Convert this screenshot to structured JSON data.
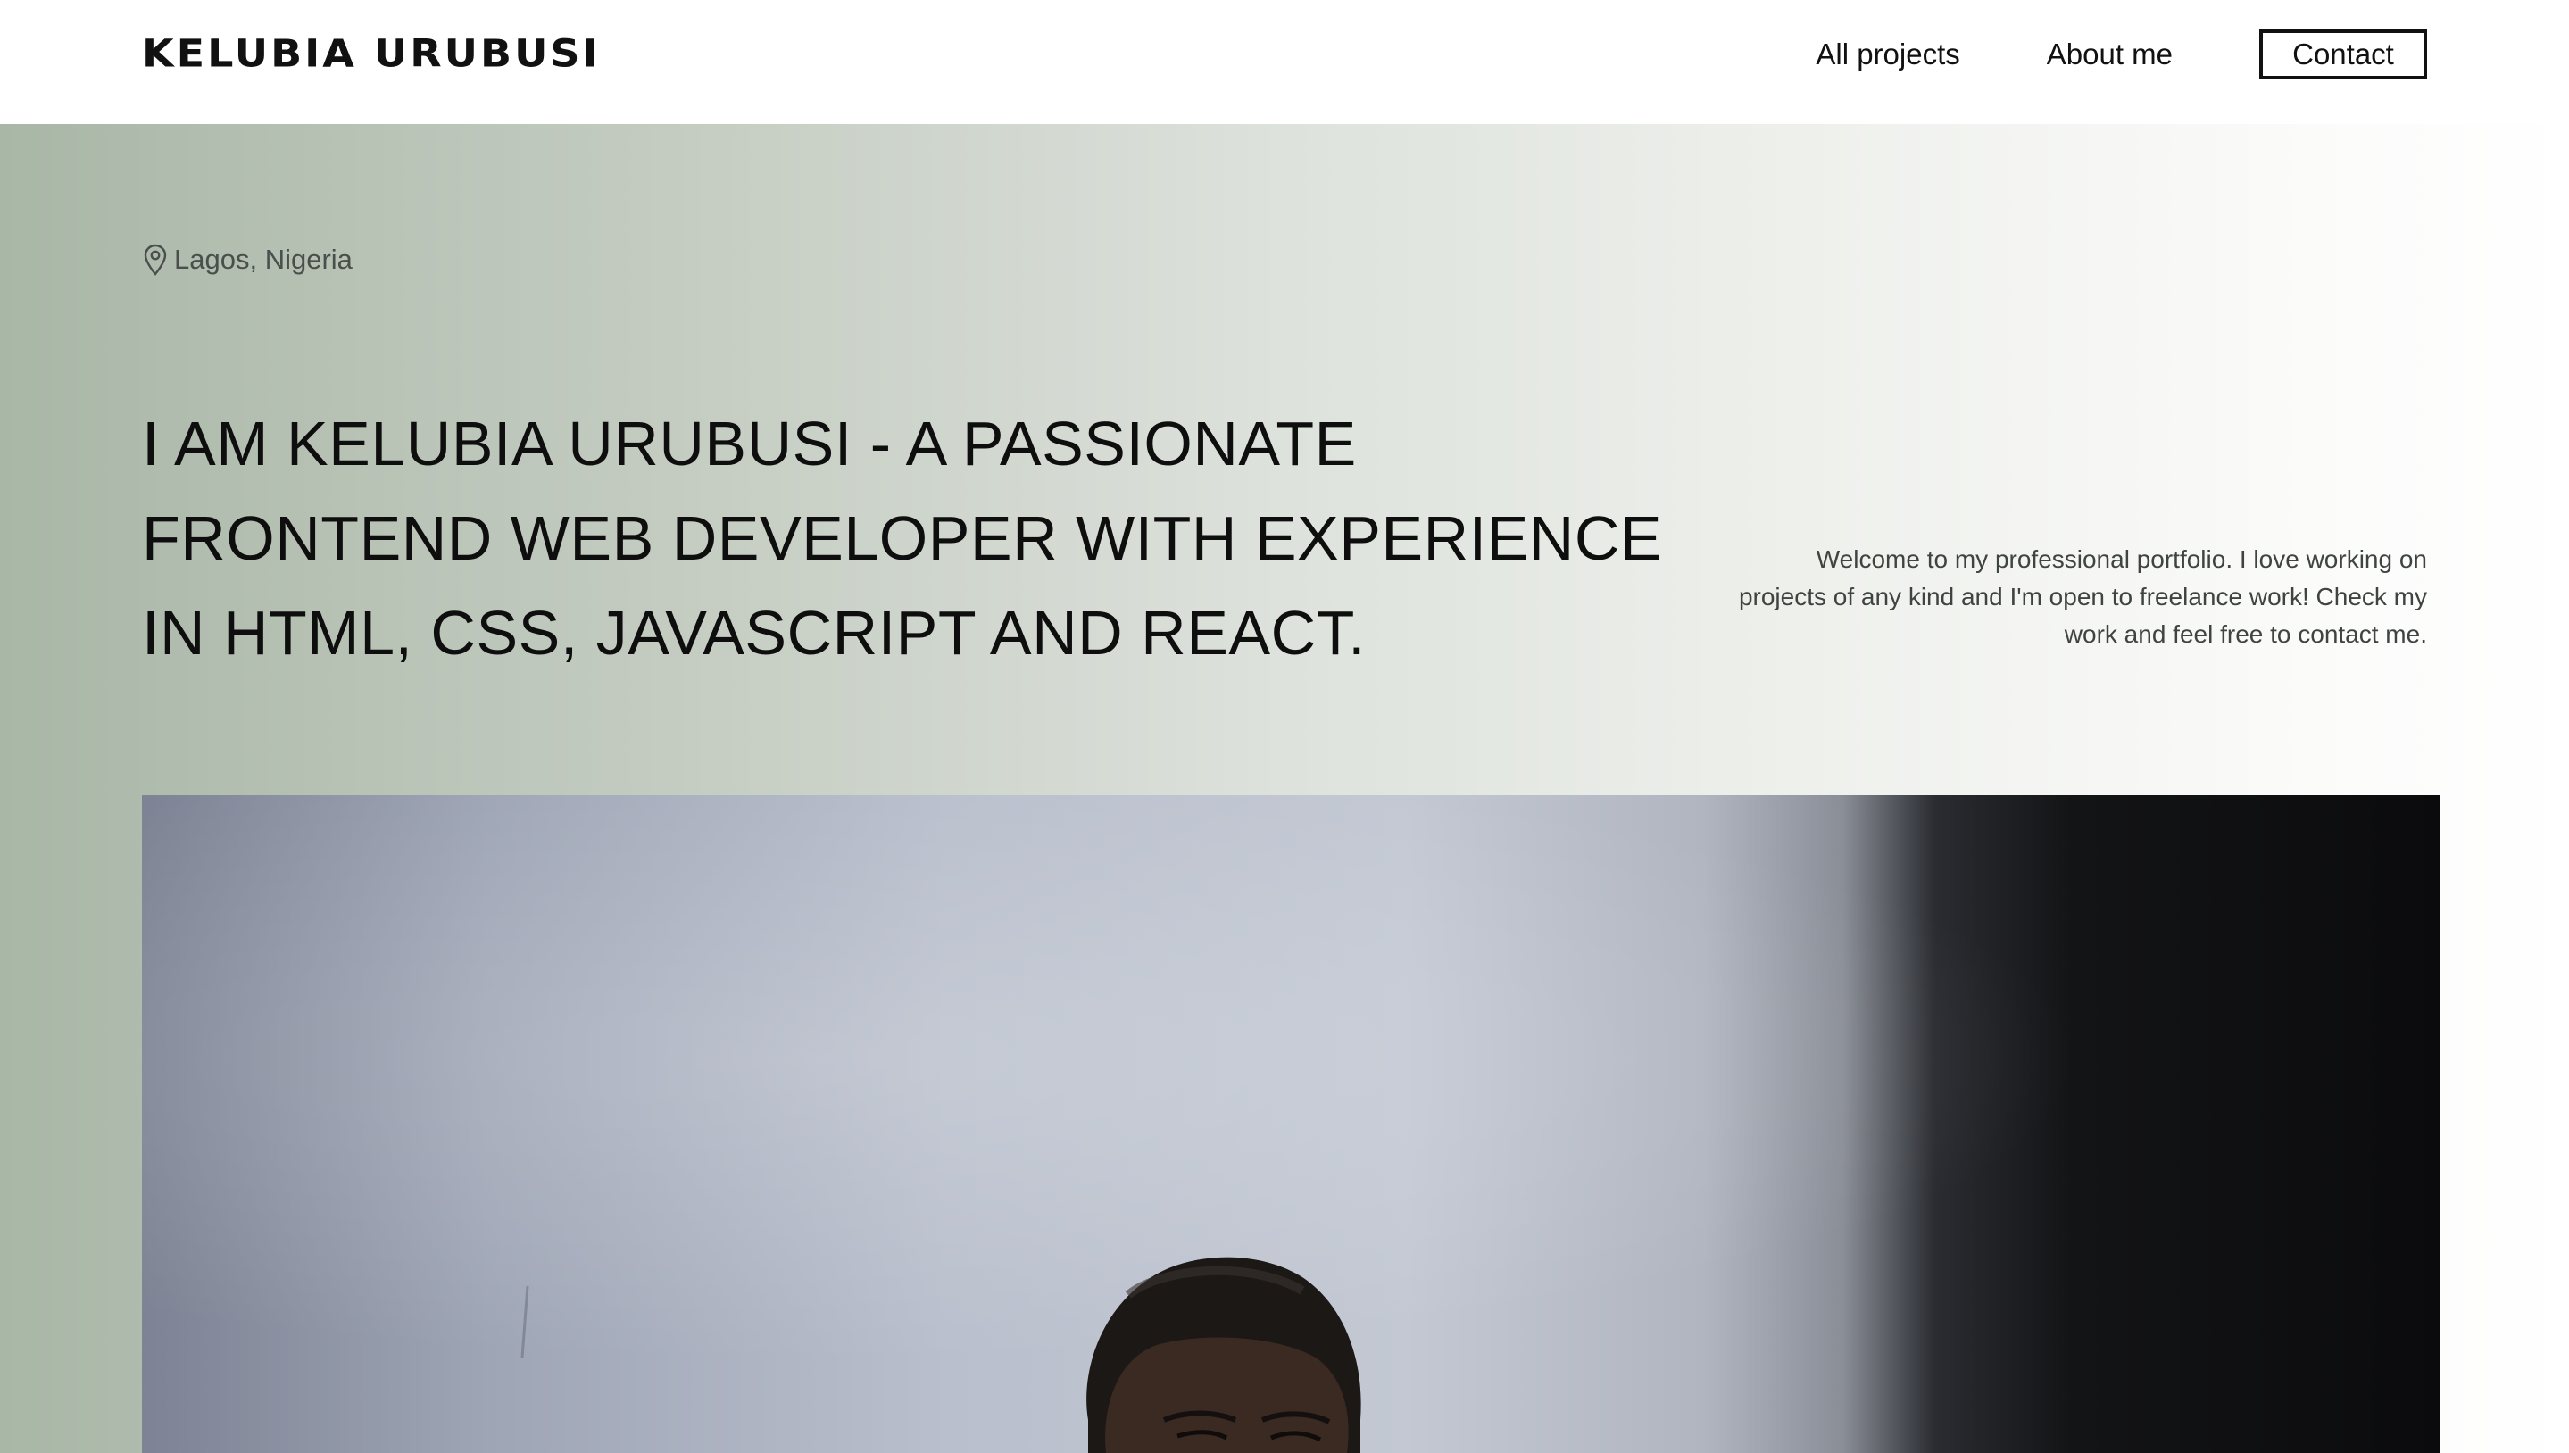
{
  "header": {
    "logo_text": "KELUBIA URUBUSI",
    "nav": {
      "projects_label": "All projects",
      "about_label": "About me",
      "contact_label": "Contact"
    }
  },
  "hero": {
    "location": "Lagos, Nigeria",
    "location_icon": "map-pin-icon",
    "headline": "I AM KELUBIA URUBUSI - A PASSIONATE FRONTEND WEB DEVELOPER WITH EXPERIENCE IN HTML, CSS, JAVASCRIPT AND REACT.",
    "intro": "Welcome to my professional portfolio. I love working on projects of any kind and I'm open to freelance work! Check my work and feel free to contact me."
  },
  "colors": {
    "text_primary": "#111111",
    "text_secondary": "#3f4441",
    "hero_gradient_start": "#a9b7a7",
    "hero_gradient_end": "#ffffff"
  }
}
